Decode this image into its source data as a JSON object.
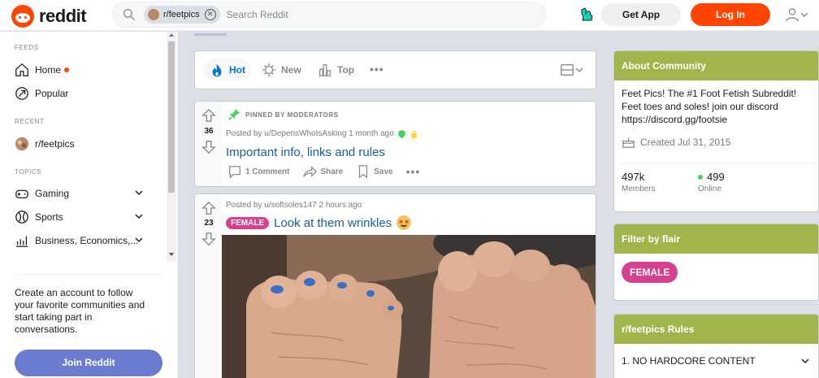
{
  "header": {
    "brand": "reddit",
    "search_chip": "r/feetpics",
    "search_placeholder": "Search Reddit",
    "get_app": "Get App",
    "login": "Log In"
  },
  "sidebar": {
    "feeds_label": "FEEDS",
    "home": "Home",
    "popular": "Popular",
    "recent_label": "RECENT",
    "recent_item": "r/feetpics",
    "topics_label": "TOPICS",
    "topics": [
      "Gaming",
      "Sports",
      "Business, Economics,..."
    ],
    "cta_text": "Create an account to follow your favorite communities and start taking part in conversations.",
    "join_button": "Join Reddit"
  },
  "sort": {
    "hot": "Hot",
    "new": "New",
    "top": "Top"
  },
  "pinned_post": {
    "pinned_label": "PINNED BY MODERATORS",
    "votes": "36",
    "posted_by": "Posted by u/DepensWhoIsAsking 1 month ago",
    "title": "Important info, links and rules",
    "comments": "1 Comment",
    "share": "Share",
    "save": "Save"
  },
  "post2": {
    "votes": "23",
    "posted_by": "Posted by u/softsoles147 2 hours ago",
    "flair": "FEMALE",
    "title": "Look at them wrinkles"
  },
  "about": {
    "heading": "About Community",
    "description": "Feet Pics! The #1 Foot Fetish Subreddit! Feet toes and soles! join our discord https://discord.gg/footsie",
    "created": "Created Jul 31, 2015",
    "members_count": "497k",
    "members_label": "Members",
    "online_count": "499",
    "online_label": "Online"
  },
  "filter": {
    "heading": "Filter by flair",
    "flair": "FEMALE"
  },
  "rules": {
    "heading": "r/feetpics Rules",
    "items": [
      "1. NO HARDCORE CONTENT"
    ]
  },
  "colors": {
    "brand": "#ff4500",
    "link": "#1a5fa0",
    "community": "#a2b54d",
    "flair": "#d6418f",
    "join": "#6b7bd0"
  }
}
